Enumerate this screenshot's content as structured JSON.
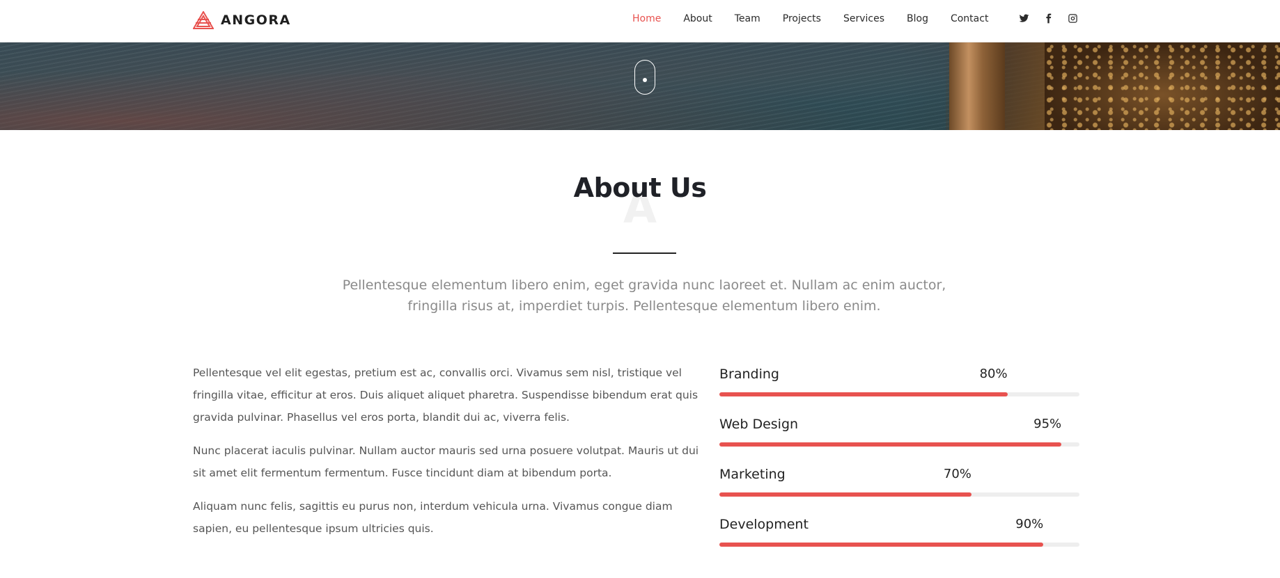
{
  "header": {
    "brand": "ANGORA",
    "nav": [
      {
        "label": "Home",
        "active": true
      },
      {
        "label": "About",
        "active": false
      },
      {
        "label": "Team",
        "active": false
      },
      {
        "label": "Projects",
        "active": false
      },
      {
        "label": "Services",
        "active": false
      },
      {
        "label": "Blog",
        "active": false
      },
      {
        "label": "Contact",
        "active": false
      }
    ],
    "social": [
      "twitter-icon",
      "facebook-icon",
      "instagram-icon"
    ]
  },
  "hero": {
    "scroll_icon": "mouse-scroll-icon"
  },
  "about": {
    "title": "About Us",
    "watermark": "A",
    "lead": "Pellentesque elementum libero enim, eget gravida nunc laoreet et. Nullam ac enim auctor, fringilla risus at, imperdiet turpis. Pellentesque elementum libero enim.",
    "paragraphs": [
      "Pellentesque vel elit egestas, pretium est ac, convallis orci. Vivamus sem nisl, tristique vel fringilla vitae, efficitur at eros. Duis aliquet aliquet pharetra. Suspendisse bibendum erat quis gravida pulvinar. Phasellus vel eros porta, blandit dui ac, viverra felis.",
      "Nunc placerat iaculis pulvinar. Nullam auctor mauris sed urna posuere volutpat. Mauris ut dui sit amet elit fermentum fermentum. Fusce tincidunt diam at bibendum porta.",
      "Aliquam nunc felis, sagittis eu purus non, interdum vehicula urna. Vivamus congue diam sapien, eu pellentesque ipsum ultricies quis."
    ],
    "skills": [
      {
        "label": "Branding",
        "percent": 80,
        "percent_text": "80%"
      },
      {
        "label": "Web Design",
        "percent": 95,
        "percent_text": "95%"
      },
      {
        "label": "Marketing",
        "percent": 70,
        "percent_text": "70%"
      },
      {
        "label": "Development",
        "percent": 90,
        "percent_text": "90%"
      }
    ]
  },
  "colors": {
    "accent": "#e8524f",
    "text_dark": "#1f2127",
    "text_muted": "#8a8a8a",
    "track": "#eeeeee"
  }
}
